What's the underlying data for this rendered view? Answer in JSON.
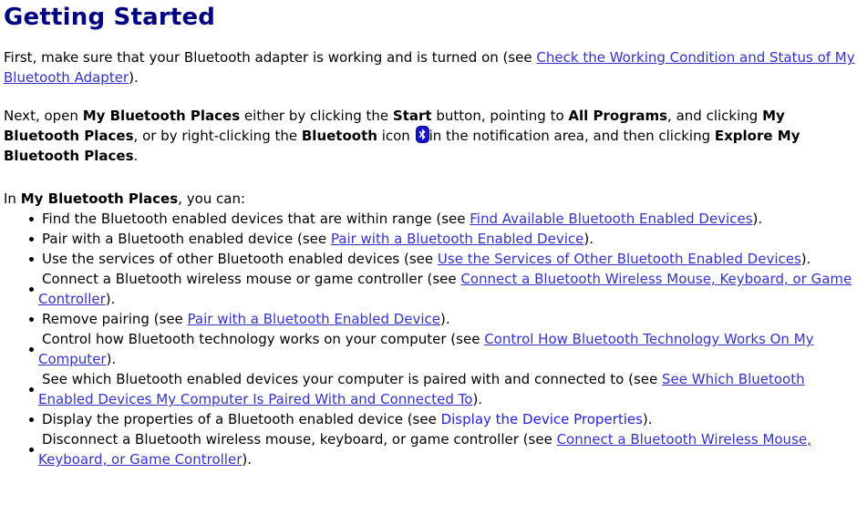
{
  "document": {
    "title": "Getting Started",
    "title_color": "#000080",
    "link_color": "#3333cc",
    "plain_link_color": "#2222dd",
    "body_color": "#000000",
    "background": "#ffffff"
  },
  "paragraphs": {
    "intro": {
      "text_1": "First, make sure that your Bluetooth adapter is working and is turned on (see ",
      "link_1": "Check the Working Condition and Status of My Bluetooth Adapter",
      "text_2": ")."
    },
    "next": {
      "text_1": "Next, open ",
      "bold_1": "My Bluetooth Places",
      "text_2": " either by clicking the ",
      "bold_2": "Start",
      "text_3": " button, pointing to ",
      "bold_3": "All Programs",
      "text_4": ", and clicking ",
      "bold_4": "My Bluetooth Places",
      "text_5": ", or by right-clicking the ",
      "bold_5": "Bluetooth",
      "text_6": " icon ",
      "icon": "bluetooth-icon",
      "text_7": "in the notification area, and then clicking ",
      "bold_6": "Explore My Bluetooth Places",
      "text_8": "."
    },
    "in_places": {
      "text_1": "In ",
      "bold_1": "My Bluetooth Places",
      "text_2": ", you can:"
    }
  },
  "feature_list": [
    {
      "text_1": "Find the Bluetooth enabled devices that are within range (see ",
      "link": "Find Available Bluetooth Enabled Devices",
      "link_style": "underline",
      "text_2": ")."
    },
    {
      "text_1": "Pair with a Bluetooth enabled device (see ",
      "link": "Pair with a Bluetooth Enabled Device",
      "link_style": "underline",
      "text_2": ")."
    },
    {
      "text_1": "Use the services of other Bluetooth enabled devices (see ",
      "link": "Use the Services of Other Bluetooth Enabled Devices",
      "link_style": "underline",
      "text_2": ")."
    },
    {
      "text_1": "Connect a Bluetooth wireless mouse or game controller (see ",
      "link": "Connect a Bluetooth Wireless Mouse, Keyboard, or Game Controller",
      "link_style": "underline",
      "text_2": ")."
    },
    {
      "text_1": "Remove pairing (see ",
      "link": "Pair with a Bluetooth Enabled Device",
      "link_style": "underline",
      "text_2": ")."
    },
    {
      "text_1": "Control how Bluetooth technology works on your computer (see ",
      "link": "Control How Bluetooth Technology Works On My Computer",
      "link_style": "underline",
      "text_2": ")."
    },
    {
      "text_1": "See which Bluetooth enabled devices your computer is paired with and connected to (see ",
      "link": "See Which Bluetooth Enabled Devices My Computer Is Paired With and Connected To",
      "link_style": "underline",
      "text_2": ")."
    },
    {
      "text_1": "Display the properties of a Bluetooth enabled device (see ",
      "link": "Display the Device Properties",
      "link_style": "plain",
      "text_2": ")."
    },
    {
      "text_1": "Disconnect a Bluetooth wireless mouse, keyboard, or game controller (see ",
      "link": "Connect a Bluetooth Wireless Mouse, Keyboard, or Game Controller",
      "link_style": "underline",
      "text_2": ")."
    }
  ]
}
